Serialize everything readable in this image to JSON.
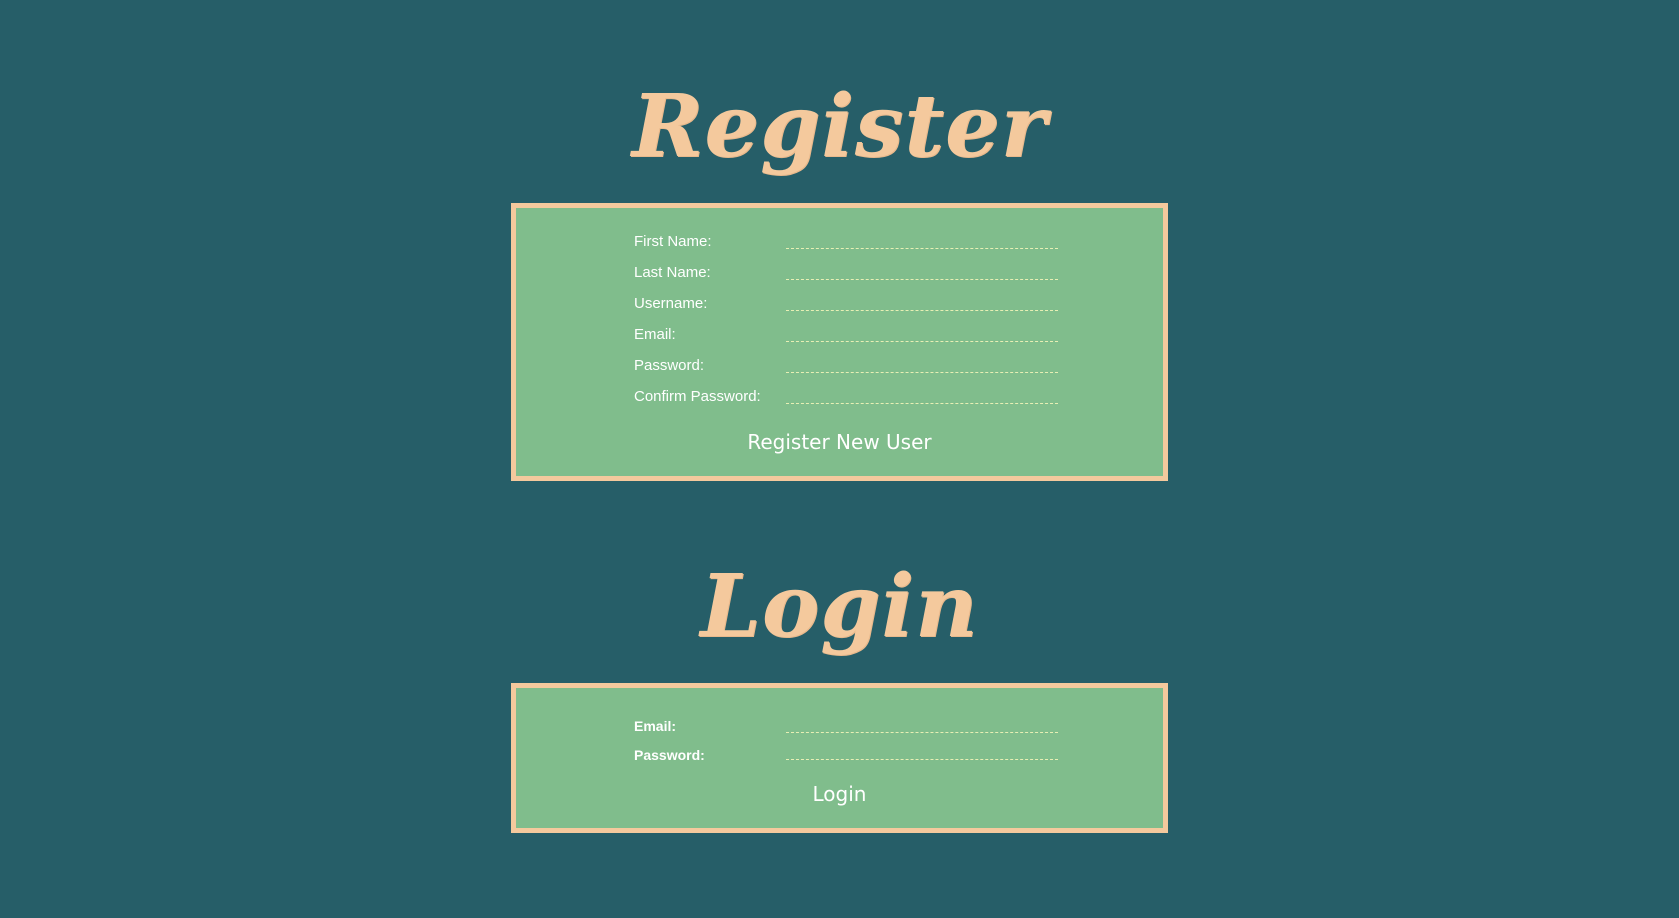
{
  "register": {
    "title": "Register",
    "fields": [
      {
        "label": "First Name:"
      },
      {
        "label": "Last Name:"
      },
      {
        "label": "Username:"
      },
      {
        "label": "Email:"
      },
      {
        "label": "Password:"
      },
      {
        "label": "Confirm Password:"
      }
    ],
    "submit_label": "Register New User"
  },
  "login": {
    "title": "Login",
    "fields": [
      {
        "label": "Email:"
      },
      {
        "label": "Password:"
      }
    ],
    "submit_label": "Login"
  },
  "colors": {
    "background": "#265e68",
    "panel": "#80bd8c",
    "accent": "#f4c99d",
    "field_underline": "#e8efb4",
    "text": "#ffffff"
  }
}
